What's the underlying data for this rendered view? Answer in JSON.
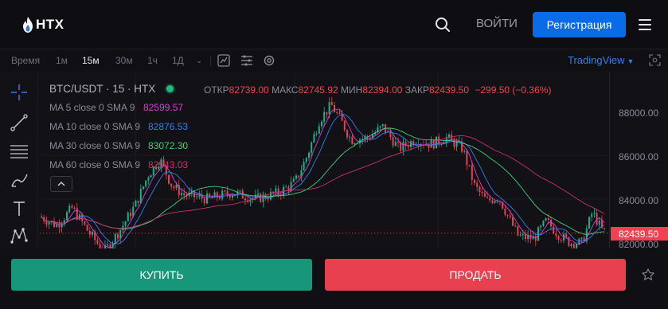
{
  "header": {
    "logo_text": "HTX",
    "login_label": "ВОЙТИ",
    "register_label": "Регистрация"
  },
  "toolbar": {
    "time_label": "Время",
    "intervals": [
      "1м",
      "15м",
      "30м",
      "1ч",
      "1Д"
    ],
    "active_interval": "15м",
    "tradingview_label": "TradingView"
  },
  "chart": {
    "symbol": "BTC/USDT · 15 · HTX",
    "ohlc": {
      "open_label": "ОТКР",
      "open": "82739.00",
      "high_label": "МАКС",
      "high": "82745.92",
      "low_label": "МИН",
      "low": "82394.00",
      "close_label": "ЗАКР",
      "close": "82439.50",
      "change": "−299.50 (−0.36%)"
    },
    "ma": [
      {
        "label": "MA 5 close 0 SMA 9",
        "value": "82599.57",
        "color": "#d63fd6"
      },
      {
        "label": "MA 10 close 0 SMA 9",
        "value": "82876.53",
        "color": "#3a7dea"
      },
      {
        "label": "MA 30 close 0 SMA 9",
        "value": "83072.30",
        "color": "#3fd07a"
      },
      {
        "label": "MA 60 close 0 SMA 9",
        "value": "82543.03",
        "color": "#c8326e"
      }
    ],
    "price_axis": [
      "88000.00",
      "86000.00",
      "84000.00",
      "82000.00"
    ],
    "current_price": "82439.50"
  },
  "actions": {
    "buy_label": "КУПИТЬ",
    "sell_label": "ПРОДАТЬ"
  },
  "colors": {
    "accent": "#0a6be8",
    "up": "#17967a",
    "down": "#e8404f"
  }
}
